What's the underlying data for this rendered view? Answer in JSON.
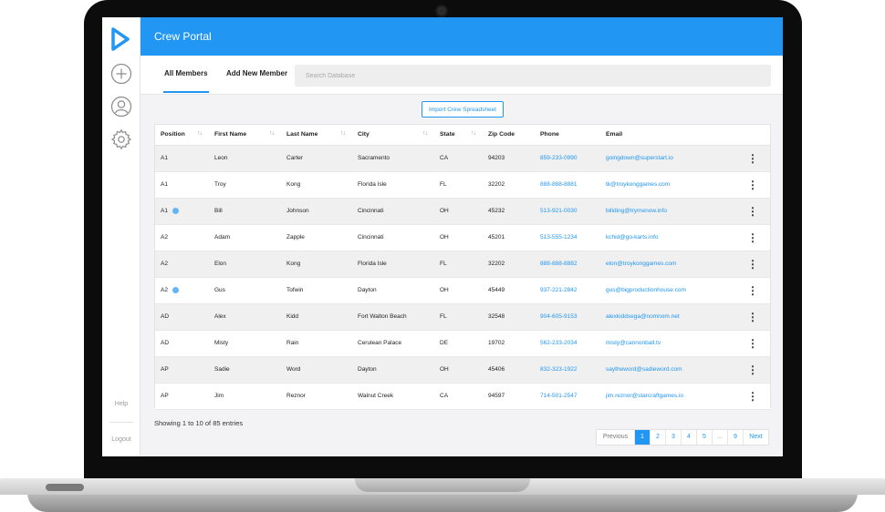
{
  "app": {
    "title": "Crew Portal",
    "accent_color": "#2196f3"
  },
  "sidebar": {
    "logo_icon": "play-triangle-logo",
    "items": [
      {
        "name": "add",
        "icon": "plus-circle-icon"
      },
      {
        "name": "profile",
        "icon": "user-circle-icon"
      },
      {
        "name": "settings",
        "icon": "gear-icon"
      }
    ],
    "help_label": "Help",
    "logout_label": "Logout"
  },
  "tabs": [
    {
      "label": "All Members",
      "active": true
    },
    {
      "label": "Add New Member",
      "active": false
    }
  ],
  "search": {
    "placeholder": "Search Database",
    "value": ""
  },
  "import_button_label": "Import Crew Spreadsheet",
  "table": {
    "columns": [
      "Position",
      "First Name",
      "Last Name",
      "City",
      "State",
      "Zip Code",
      "Phone",
      "Email"
    ],
    "sortable": [
      true,
      true,
      true,
      true,
      true,
      false,
      false,
      false
    ],
    "sort_icon": "↑↓",
    "kebab_icon": "⋮",
    "rows": [
      {
        "position": "A1",
        "info": false,
        "first": "Leon",
        "last": "Carter",
        "city": "Sacramento",
        "state": "CA",
        "zip": "94203",
        "phone": "859-233-0990",
        "email": "goingdown@superstart.io"
      },
      {
        "position": "A1",
        "info": false,
        "first": "Troy",
        "last": "Kong",
        "city": "Florida Isle",
        "state": "FL",
        "zip": "32202",
        "phone": "888-888-8881",
        "email": "tk@troykonggames.com"
      },
      {
        "position": "A1",
        "info": true,
        "first": "Bill",
        "last": "Johnson",
        "city": "Cincinnati",
        "state": "OH",
        "zip": "45232",
        "phone": "513-921-0030",
        "email": "billding@trymenow.info"
      },
      {
        "position": "A2",
        "info": false,
        "first": "Adam",
        "last": "Zapple",
        "city": "Cincinnati",
        "state": "OH",
        "zip": "45201",
        "phone": "513-555-1234",
        "email": "kchid@go-karts.info"
      },
      {
        "position": "A2",
        "info": false,
        "first": "Elon",
        "last": "Kong",
        "city": "Florida Isle",
        "state": "FL",
        "zip": "32202",
        "phone": "888-888-8882",
        "email": "elon@troykonggames.com"
      },
      {
        "position": "A2",
        "info": true,
        "first": "Gus",
        "last": "Tofwin",
        "city": "Dayton",
        "state": "OH",
        "zip": "45449",
        "phone": "937-221-2842",
        "email": "gus@bigproductionhouse.com"
      },
      {
        "position": "AD",
        "info": false,
        "first": "Alex",
        "last": "Kidd",
        "city": "Fort Walton Beach",
        "state": "FL",
        "zip": "32548",
        "phone": "904-605-9153",
        "email": "alexkiddsega@nomnom.net"
      },
      {
        "position": "AD",
        "info": false,
        "first": "Misty",
        "last": "Rain",
        "city": "Cerulean Palace",
        "state": "DE",
        "zip": "19702",
        "phone": "562-233-2034",
        "email": "misty@cannonball.tv"
      },
      {
        "position": "AP",
        "info": false,
        "first": "Sadie",
        "last": "Word",
        "city": "Dayton",
        "state": "OH",
        "zip": "45406",
        "phone": "832-323-1922",
        "email": "saytheword@sadieword.com"
      },
      {
        "position": "AP",
        "info": false,
        "first": "Jim",
        "last": "Reznor",
        "city": "Walnut Creek",
        "state": "CA",
        "zip": "94597",
        "phone": "714-501-2547",
        "email": "jim.reznor@starcraftgames.io"
      }
    ]
  },
  "footer": {
    "entries_text": "Showing 1 to 10 of 85 entries",
    "pagination": [
      "Previous",
      "1",
      "2",
      "3",
      "4",
      "5",
      "...",
      "9",
      "Next"
    ],
    "current_page": "1"
  }
}
